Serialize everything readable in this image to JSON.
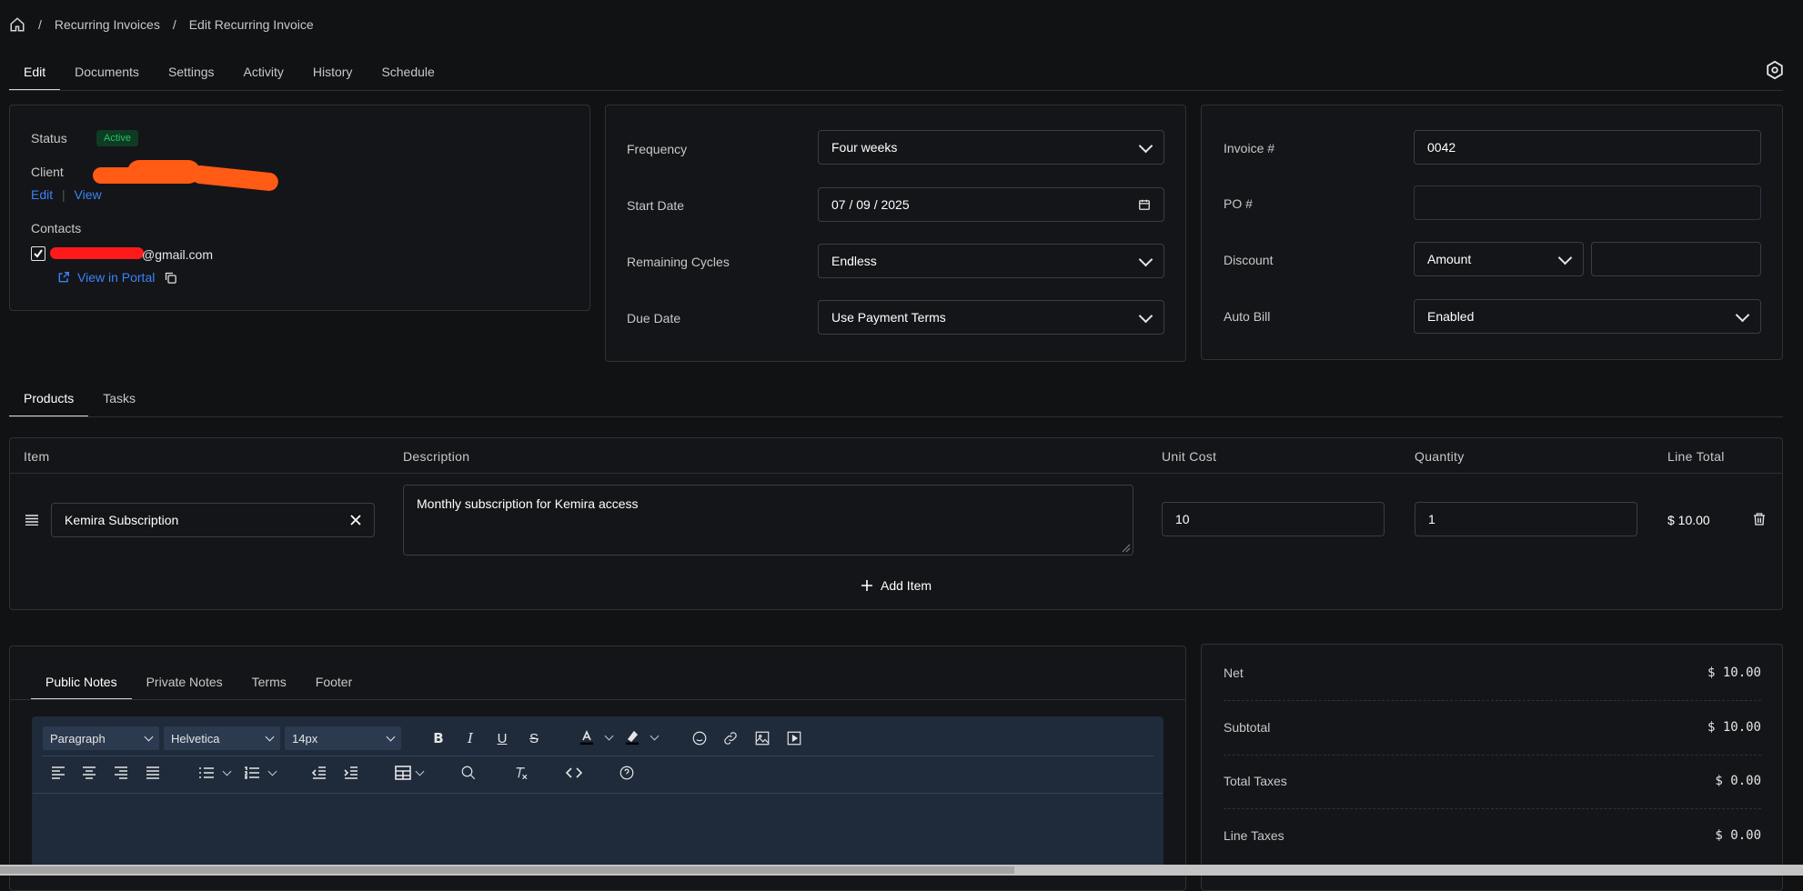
{
  "breadcrumb": {
    "items": [
      "Recurring Invoices",
      "Edit Recurring Invoice"
    ],
    "separator": "/"
  },
  "top_tabs": [
    "Edit",
    "Documents",
    "Settings",
    "Activity",
    "History",
    "Schedule"
  ],
  "client_card": {
    "status_label": "Status",
    "status_badge": "Active",
    "client_label": "Client",
    "edit_link": "Edit",
    "link_sep": "|",
    "view_link": "View",
    "contacts_label": "Contacts",
    "contact_email_suffix": "@gmail.com",
    "view_portal": "View in Portal"
  },
  "schedule_card": {
    "frequency_label": "Frequency",
    "frequency_value": "Four weeks",
    "start_date_label": "Start Date",
    "start_date_value": "07 / 09 / 2025",
    "remaining_label": "Remaining Cycles",
    "remaining_value": "Endless",
    "due_label": "Due Date",
    "due_value": "Use Payment Terms"
  },
  "invoice_card": {
    "invoice_label": "Invoice #",
    "invoice_value": "0042",
    "po_label": "PO #",
    "po_value": "",
    "discount_label": "Discount",
    "discount_type": "Amount",
    "discount_value": "",
    "autobill_label": "Auto Bill",
    "autobill_value": "Enabled"
  },
  "product_tabs": [
    "Products",
    "Tasks"
  ],
  "table": {
    "headers": [
      "Item",
      "Description",
      "Unit Cost",
      "Quantity",
      "Line Total"
    ],
    "row": {
      "item": "Kemira Subscription",
      "description": "Monthly subscription for Kemira access",
      "unit_cost": "10",
      "quantity": "1",
      "line_total": "$ 10.00"
    },
    "add_item": "Add Item"
  },
  "notes_tabs": [
    "Public Notes",
    "Private Notes",
    "Terms",
    "Footer"
  ],
  "editor": {
    "block_format": "Paragraph",
    "font_family": "Helvetica",
    "font_size": "14px"
  },
  "totals": [
    {
      "label": "Net",
      "value": "$ 10.00"
    },
    {
      "label": "Subtotal",
      "value": "$ 10.00"
    },
    {
      "label": "Total Taxes",
      "value": "$ 0.00"
    },
    {
      "label": "Line Taxes",
      "value": "$ 0.00"
    }
  ],
  "colors": {
    "accent_link": "#3b82f6",
    "badge_green": "#22c55e",
    "background": "#111214",
    "toolbar": "#1f2a3a"
  }
}
